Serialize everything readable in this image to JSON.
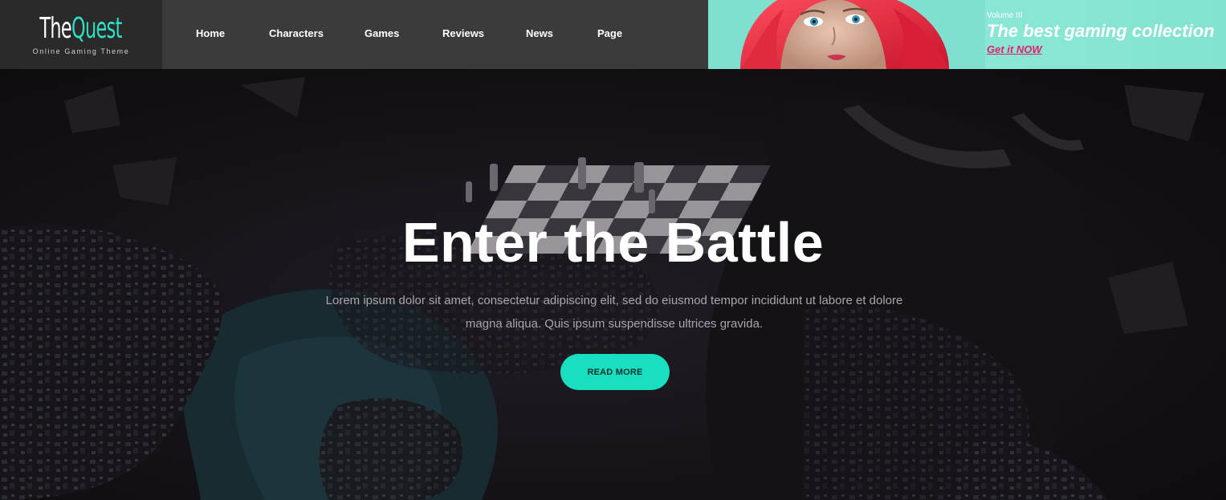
{
  "logo": {
    "brand_part1": "The",
    "brand_part2": "Quest",
    "tagline": "Online Gaming Theme",
    "accent_color": "#2ee0c1"
  },
  "nav": {
    "items": [
      {
        "label": "Home"
      },
      {
        "label": "Characters"
      },
      {
        "label": "Games"
      },
      {
        "label": "Reviews"
      },
      {
        "label": "News"
      },
      {
        "label": "Page"
      }
    ]
  },
  "banner": {
    "volume": "Volume III",
    "title": "The best gaming collection",
    "cta": "Get it NOW",
    "cta_color": "#e0226e",
    "background_color": "#82e3d1"
  },
  "hero": {
    "title": "Enter the Battle",
    "description": "Lorem ipsum dolor sit amet, consectetur adipiscing elit, sed do eiusmod tempor incididunt ut labore et dolore magna aliqua. Quis ipsum suspendisse ultrices gravida.",
    "button_label": "READ MORE",
    "button_color": "#19dfc0"
  }
}
